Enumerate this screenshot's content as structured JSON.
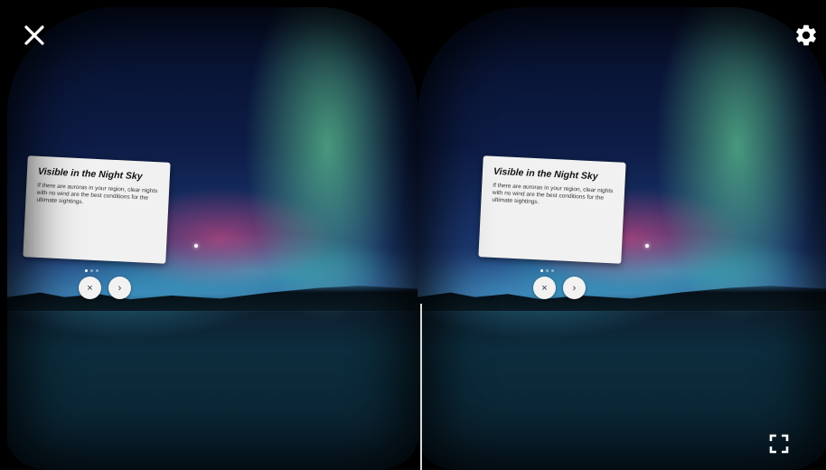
{
  "toolbar": {
    "close_icon": "close-icon",
    "settings_icon": "gear-icon",
    "fullscreen_icon": "fullscreen-icon"
  },
  "card": {
    "title": "Visible in the Night Sky",
    "body": "If there are auroras in your region, clear nights with no wind are the best conditions for the ultimate sightings.",
    "page_indicator": {
      "total": 3,
      "active": 1
    },
    "close_button": "×",
    "next_button": "›"
  },
  "colors": {
    "card_background": "#f1f1f1",
    "aurora_green": "#78ffaa",
    "aurora_pink": "#ff4682",
    "divider": "#d8d8d8"
  }
}
